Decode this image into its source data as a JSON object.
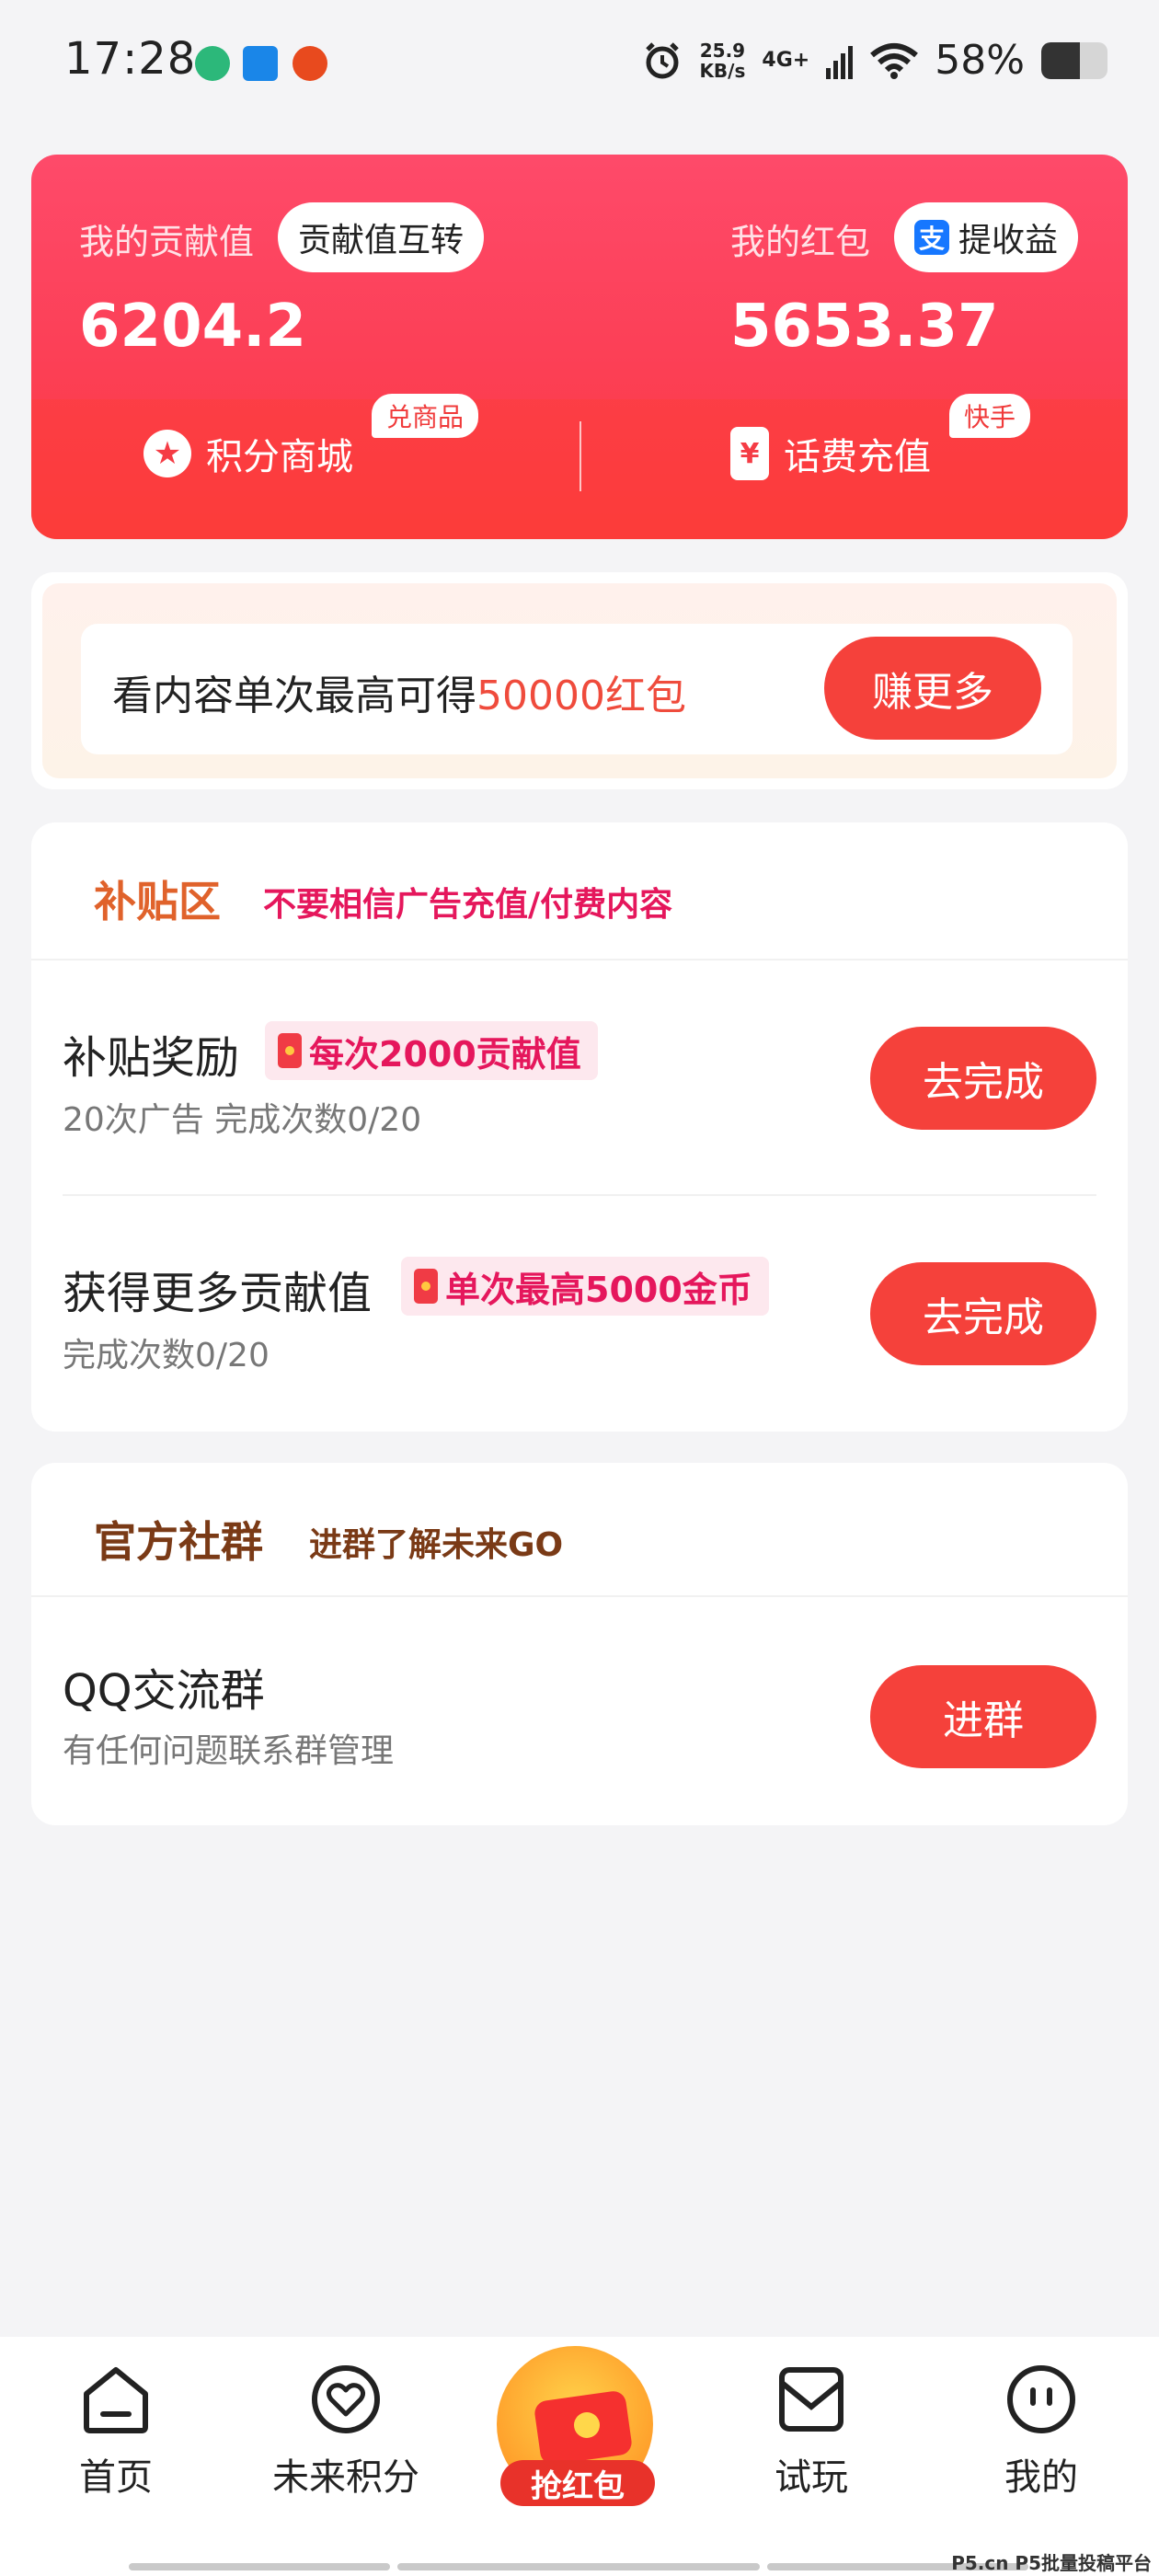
{
  "status_bar": {
    "time": "17:28",
    "net_speed_value": "25.9",
    "net_speed_unit": "KB/s",
    "network": "4G+",
    "battery_percent_text": "58%",
    "battery_level": 0.58
  },
  "hero": {
    "contribution_label": "我的贡献值",
    "contribution_value": "6204.2",
    "transfer_button": "贡献值互转",
    "redpacket_label": "我的红包",
    "redpacket_value": "5653.37",
    "withdraw_button": "提收益",
    "mall_label": "积分商城",
    "mall_tag": "兑商品",
    "recharge_label": "话费充值",
    "recharge_tag": "快手"
  },
  "promo": {
    "text_prefix": "看内容单次最高可得",
    "text_highlight": "50000红包",
    "button": "赚更多"
  },
  "subsidy": {
    "title": "补贴区",
    "subtitle": "不要相信广告充值/付费内容",
    "tasks": [
      {
        "title": "补贴奖励",
        "badge": "每次2000贡献值",
        "desc": "20次广告  完成次数0/20",
        "button": "去完成"
      },
      {
        "title": "获得更多贡献值",
        "badge": "单次最高5000金币",
        "desc": "完成次数0/20",
        "button": "去完成"
      }
    ]
  },
  "community": {
    "title": "官方社群",
    "subtitle": "进群了解未来GO",
    "item_title": "QQ交流群",
    "item_desc": "有任何问题联系群管理",
    "button": "进群"
  },
  "tabbar": {
    "home": "首页",
    "points": "未来积分",
    "grab": "抢红包",
    "trial": "试玩",
    "mine": "我的"
  },
  "watermark": "P5.cn P5批量投稿平台",
  "colors": {
    "accent_red": "#f5413b",
    "title_orange": "#e0622b",
    "subtitle_pink": "#e5175c",
    "community_brown": "#7a3a16"
  }
}
